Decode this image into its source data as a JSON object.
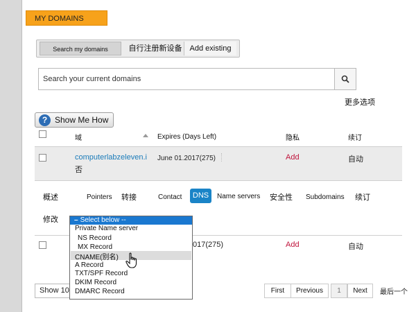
{
  "brand": {
    "title": "MY DOMAINS"
  },
  "tabs": {
    "search": "Search my domains",
    "register": "自行注册新设备",
    "add": "Add existing"
  },
  "search": {
    "placeholder": "Search your current domains"
  },
  "more_options": "更多选项",
  "show_me_how": "Show Me How",
  "table": {
    "headers": {
      "domain": "域",
      "expires": "Expires (Days Left)",
      "privacy": "隐私",
      "renew": "续订"
    },
    "rows": [
      {
        "domain_line1": "computerlabzeleven.i",
        "domain_line2": "否",
        "expires": "June 01.2017(275)",
        "privacy": "Add",
        "renew": "自动"
      },
      {
        "expires_partial": "017(275)",
        "privacy": "Add",
        "renew": "自动"
      }
    ]
  },
  "subtabs": {
    "overview": "概述",
    "pointers": "Pointers",
    "transfer": "转接",
    "contact": "Contact",
    "dns": "DNS",
    "nameservers": "Name servers",
    "security": "安全性",
    "subdomains": "Subdomains",
    "renew": "续订",
    "edit": "修改"
  },
  "dropdown": {
    "selected": "Select below --",
    "items": [
      "Private Name server",
      "NS Record",
      "MX Record",
      "CNAME(别名)",
      "A Record",
      "TXT/SPF Record",
      "DKIM Record",
      "DMARC Record"
    ],
    "highlighted_index": 3
  },
  "show_select": {
    "value": "Show 10"
  },
  "pager": {
    "first": "First",
    "previous": "Previous",
    "page": "1",
    "next": "Next",
    "last": "最后一个"
  },
  "colors": {
    "brand": "#f7a21b",
    "link": "#1a7bb9",
    "add": "#c0143c",
    "dns_active": "#1a84c7",
    "dropdown_head": "#1a78d0"
  }
}
